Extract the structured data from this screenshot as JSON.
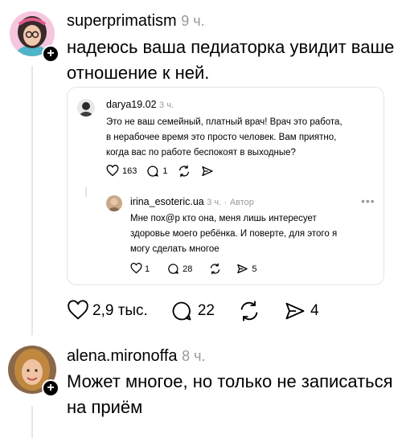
{
  "post1": {
    "username": "superprimatism",
    "time": "9 ч.",
    "text_line1": "надеюсь ваша педиаторка увидит ваше",
    "text_line2": "отношение к ней."
  },
  "quote": {
    "comment1": {
      "username": "darya19.02",
      "time": "3 ч.",
      "text_line1": "Это не ваш семейный, платный врач! Врач это работа,",
      "text_line2": "в нерабочее время это просто человек. Вам приятно,",
      "text_line3": "когда вас по работе беспокоят в выходные?",
      "likes": "163",
      "replies": "1"
    },
    "comment2": {
      "username": "irina_esoteric.ua",
      "time": "3 ч.",
      "author_tag": "Автор",
      "text_line1": "Мне пох@р кто она, меня лишь интересует",
      "text_line2": "здоровье моего ребёнка. И поверте, для  этого я",
      "text_line3": "могу сделать многое",
      "likes": "1",
      "replies": "28",
      "shares": "5"
    }
  },
  "post1_actions": {
    "likes": "2,9 тыс.",
    "replies": "22",
    "shares": "4"
  },
  "post2": {
    "username": "alena.mironoffa",
    "time": "8 ч.",
    "text_line1": "Может многое, но только не записаться",
    "text_line2": "на приём"
  },
  "icons": [
    "heart-icon",
    "comment-icon",
    "repost-icon",
    "share-icon",
    "more-icon",
    "plus-icon"
  ]
}
